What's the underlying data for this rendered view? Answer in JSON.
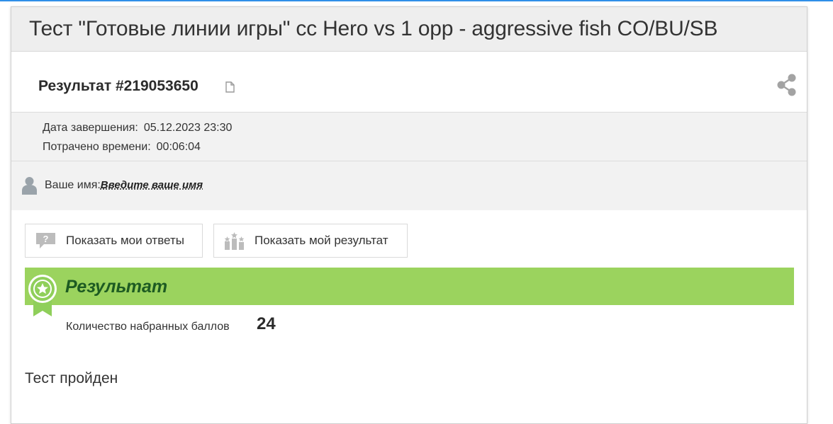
{
  "test": {
    "title": "Тест \"Готовые линии игры\" cc Hero vs 1 opp - aggressive fish CO/BU/SB"
  },
  "result": {
    "title": "Результат #219053650"
  },
  "meta": {
    "completion_label": "Дата завершения:",
    "completion_value": "05.12.2023 23:30",
    "time_label": "Потрачено времени:",
    "time_value": "00:06:04"
  },
  "user": {
    "name_label": "Ваше имя:",
    "name_placeholder": "Введите ваше имя"
  },
  "actions": {
    "show_answers_label": "Показать мои ответы",
    "show_result_label": "Показать мой результат"
  },
  "result_section": {
    "banner_title": "Результат",
    "score_label": "Количество набранных баллов",
    "score_value": "24",
    "status_text": "Тест пройден"
  },
  "colors": {
    "banner": "#9bd35e",
    "banner_text": "#1d5b22",
    "accent_top": "#2f8fe8"
  },
  "icons": {
    "copy": "copy-icon",
    "share": "share-icon",
    "user": "user-icon",
    "answers": "question-bubble-icon",
    "leaderboard": "leaderboard-icon",
    "badge": "award-badge-icon"
  }
}
